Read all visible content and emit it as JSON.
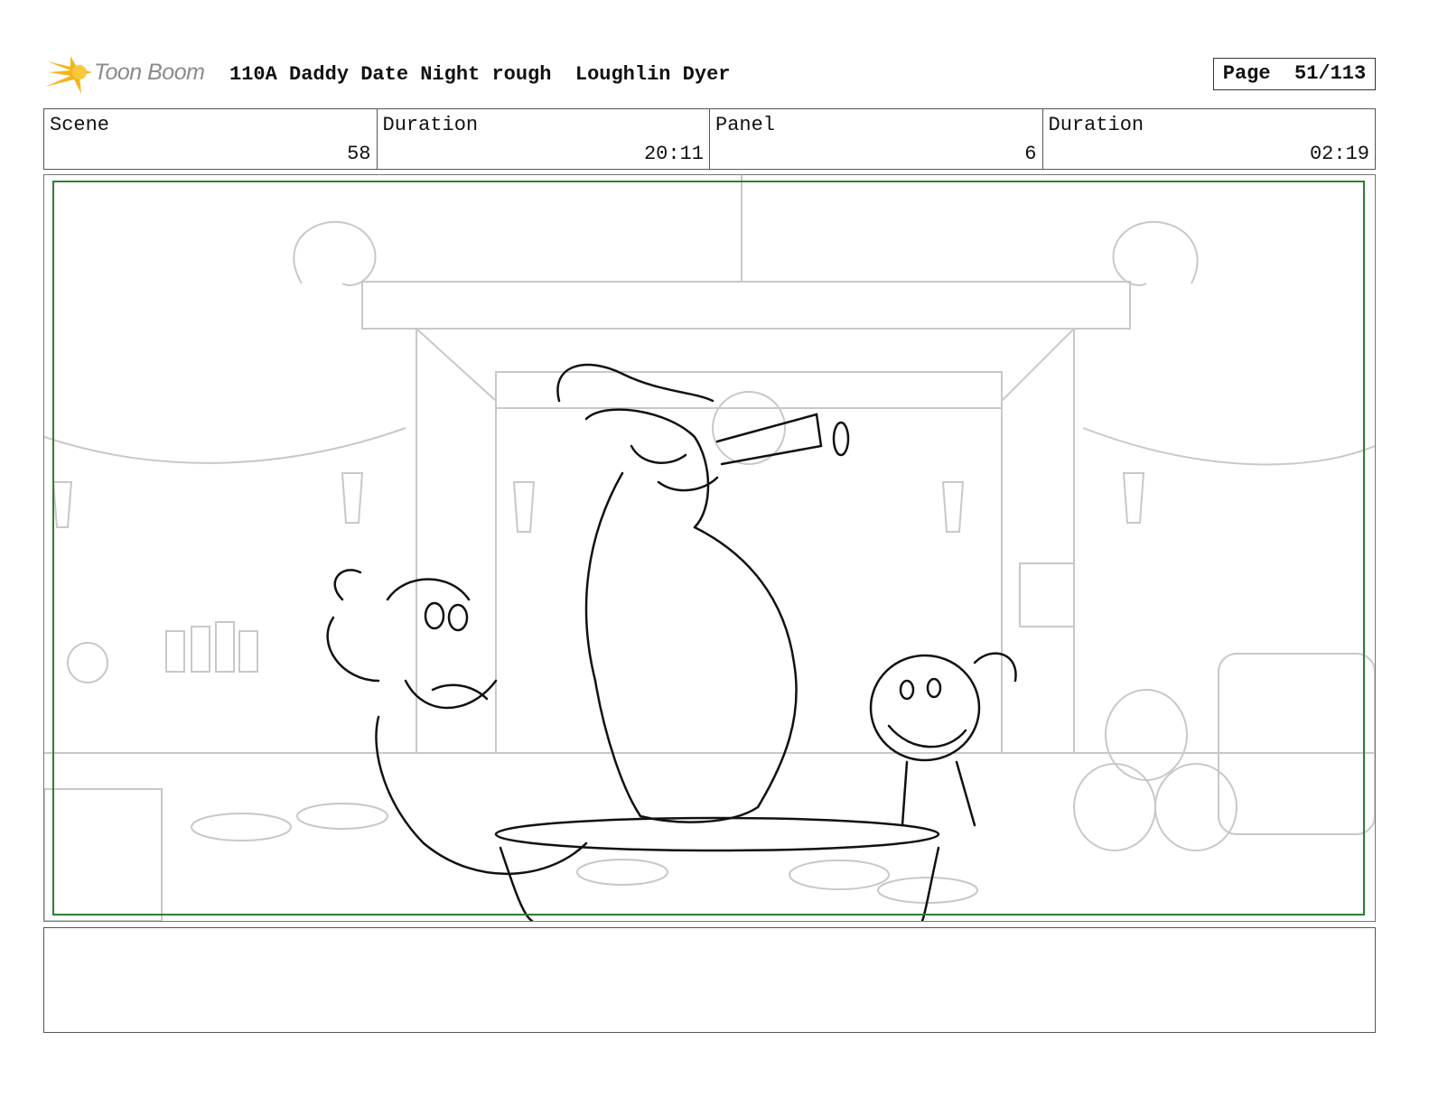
{
  "header": {
    "logo_text": "Toon Boom",
    "title": "110A Daddy Date Night rough  Loughlin Dyer",
    "page_label": "Page  51/113"
  },
  "info": {
    "scene_label": "Scene",
    "scene_value": "58",
    "scene_duration_label": "Duration",
    "scene_duration_value": "20:11",
    "panel_label": "Panel",
    "panel_value": "6",
    "panel_duration_label": "Duration",
    "panel_duration_value": "02:19"
  },
  "colors": {
    "safe_frame": "#2e7d32",
    "background_lines": "#c8c8c8",
    "character_lines": "#111111",
    "logo_star": "#f2b51c"
  },
  "notes": {
    "text": ""
  }
}
